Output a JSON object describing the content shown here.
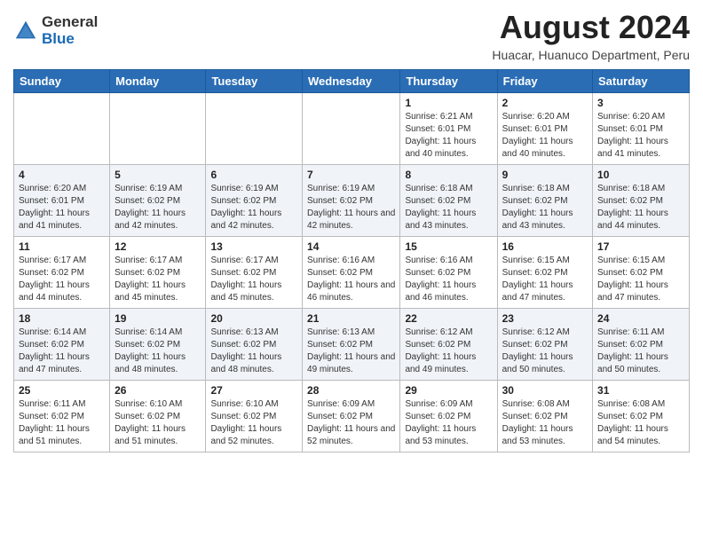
{
  "logo": {
    "general": "General",
    "blue": "Blue"
  },
  "title": "August 2024",
  "subtitle": "Huacar, Huanuco Department, Peru",
  "headers": [
    "Sunday",
    "Monday",
    "Tuesday",
    "Wednesday",
    "Thursday",
    "Friday",
    "Saturday"
  ],
  "weeks": [
    [
      {
        "day": "",
        "info": ""
      },
      {
        "day": "",
        "info": ""
      },
      {
        "day": "",
        "info": ""
      },
      {
        "day": "",
        "info": ""
      },
      {
        "day": "1",
        "info": "Sunrise: 6:21 AM\nSunset: 6:01 PM\nDaylight: 11 hours and 40 minutes."
      },
      {
        "day": "2",
        "info": "Sunrise: 6:20 AM\nSunset: 6:01 PM\nDaylight: 11 hours and 40 minutes."
      },
      {
        "day": "3",
        "info": "Sunrise: 6:20 AM\nSunset: 6:01 PM\nDaylight: 11 hours and 41 minutes."
      }
    ],
    [
      {
        "day": "4",
        "info": "Sunrise: 6:20 AM\nSunset: 6:01 PM\nDaylight: 11 hours and 41 minutes."
      },
      {
        "day": "5",
        "info": "Sunrise: 6:19 AM\nSunset: 6:02 PM\nDaylight: 11 hours and 42 minutes."
      },
      {
        "day": "6",
        "info": "Sunrise: 6:19 AM\nSunset: 6:02 PM\nDaylight: 11 hours and 42 minutes."
      },
      {
        "day": "7",
        "info": "Sunrise: 6:19 AM\nSunset: 6:02 PM\nDaylight: 11 hours and 42 minutes."
      },
      {
        "day": "8",
        "info": "Sunrise: 6:18 AM\nSunset: 6:02 PM\nDaylight: 11 hours and 43 minutes."
      },
      {
        "day": "9",
        "info": "Sunrise: 6:18 AM\nSunset: 6:02 PM\nDaylight: 11 hours and 43 minutes."
      },
      {
        "day": "10",
        "info": "Sunrise: 6:18 AM\nSunset: 6:02 PM\nDaylight: 11 hours and 44 minutes."
      }
    ],
    [
      {
        "day": "11",
        "info": "Sunrise: 6:17 AM\nSunset: 6:02 PM\nDaylight: 11 hours and 44 minutes."
      },
      {
        "day": "12",
        "info": "Sunrise: 6:17 AM\nSunset: 6:02 PM\nDaylight: 11 hours and 45 minutes."
      },
      {
        "day": "13",
        "info": "Sunrise: 6:17 AM\nSunset: 6:02 PM\nDaylight: 11 hours and 45 minutes."
      },
      {
        "day": "14",
        "info": "Sunrise: 6:16 AM\nSunset: 6:02 PM\nDaylight: 11 hours and 46 minutes."
      },
      {
        "day": "15",
        "info": "Sunrise: 6:16 AM\nSunset: 6:02 PM\nDaylight: 11 hours and 46 minutes."
      },
      {
        "day": "16",
        "info": "Sunrise: 6:15 AM\nSunset: 6:02 PM\nDaylight: 11 hours and 47 minutes."
      },
      {
        "day": "17",
        "info": "Sunrise: 6:15 AM\nSunset: 6:02 PM\nDaylight: 11 hours and 47 minutes."
      }
    ],
    [
      {
        "day": "18",
        "info": "Sunrise: 6:14 AM\nSunset: 6:02 PM\nDaylight: 11 hours and 47 minutes."
      },
      {
        "day": "19",
        "info": "Sunrise: 6:14 AM\nSunset: 6:02 PM\nDaylight: 11 hours and 48 minutes."
      },
      {
        "day": "20",
        "info": "Sunrise: 6:13 AM\nSunset: 6:02 PM\nDaylight: 11 hours and 48 minutes."
      },
      {
        "day": "21",
        "info": "Sunrise: 6:13 AM\nSunset: 6:02 PM\nDaylight: 11 hours and 49 minutes."
      },
      {
        "day": "22",
        "info": "Sunrise: 6:12 AM\nSunset: 6:02 PM\nDaylight: 11 hours and 49 minutes."
      },
      {
        "day": "23",
        "info": "Sunrise: 6:12 AM\nSunset: 6:02 PM\nDaylight: 11 hours and 50 minutes."
      },
      {
        "day": "24",
        "info": "Sunrise: 6:11 AM\nSunset: 6:02 PM\nDaylight: 11 hours and 50 minutes."
      }
    ],
    [
      {
        "day": "25",
        "info": "Sunrise: 6:11 AM\nSunset: 6:02 PM\nDaylight: 11 hours and 51 minutes."
      },
      {
        "day": "26",
        "info": "Sunrise: 6:10 AM\nSunset: 6:02 PM\nDaylight: 11 hours and 51 minutes."
      },
      {
        "day": "27",
        "info": "Sunrise: 6:10 AM\nSunset: 6:02 PM\nDaylight: 11 hours and 52 minutes."
      },
      {
        "day": "28",
        "info": "Sunrise: 6:09 AM\nSunset: 6:02 PM\nDaylight: 11 hours and 52 minutes."
      },
      {
        "day": "29",
        "info": "Sunrise: 6:09 AM\nSunset: 6:02 PM\nDaylight: 11 hours and 53 minutes."
      },
      {
        "day": "30",
        "info": "Sunrise: 6:08 AM\nSunset: 6:02 PM\nDaylight: 11 hours and 53 minutes."
      },
      {
        "day": "31",
        "info": "Sunrise: 6:08 AM\nSunset: 6:02 PM\nDaylight: 11 hours and 54 minutes."
      }
    ]
  ]
}
